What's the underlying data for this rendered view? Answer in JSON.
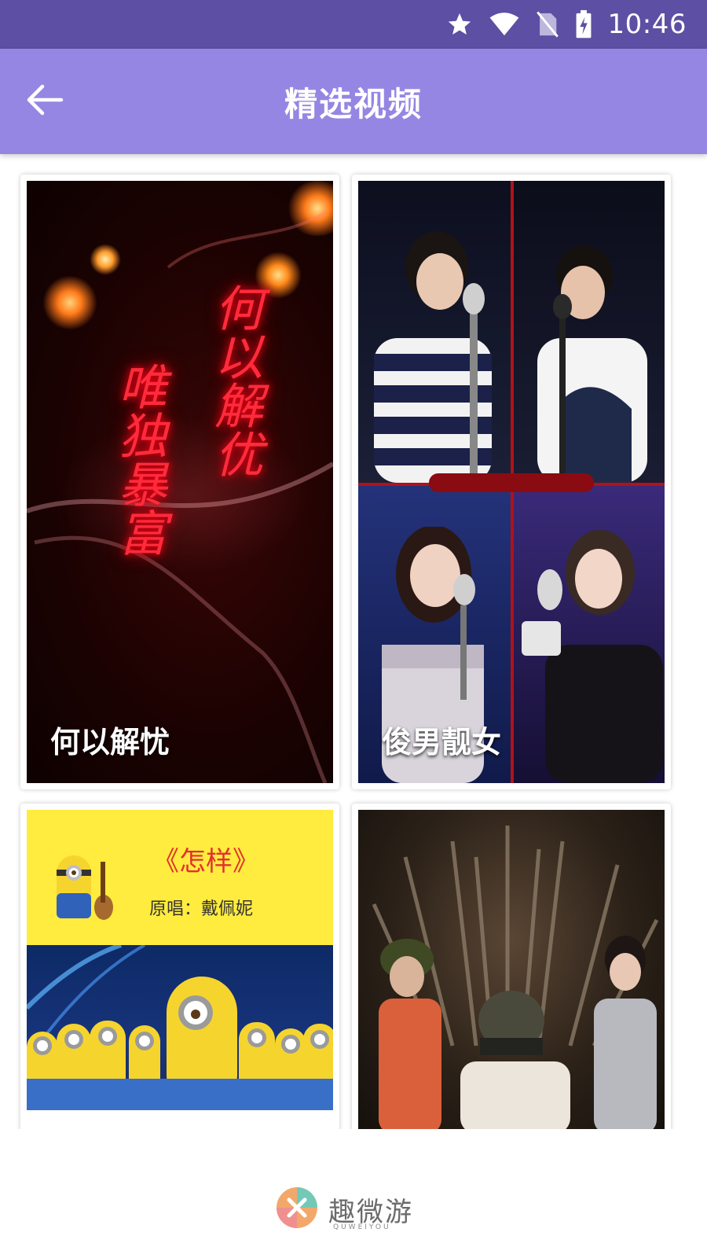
{
  "status_bar": {
    "time": "10:46",
    "icons": [
      "star-icon",
      "wifi-icon",
      "no-sim-icon",
      "battery-charging-icon"
    ]
  },
  "app_bar": {
    "title": "精选视频",
    "back_icon": "arrow-left-icon"
  },
  "videos": [
    {
      "caption": "何以解忧",
      "art_text": [
        "何以解优",
        "唯独暴富"
      ]
    },
    {
      "caption": "俊男靓女"
    },
    {
      "caption": "",
      "art_text": [
        "《怎样》",
        "原唱：戴佩妮"
      ]
    },
    {
      "caption": ""
    }
  ],
  "watermark": {
    "text": "趣微游",
    "sub": "QUWEIYOU"
  },
  "colors": {
    "status_bar": "#5d4fa3",
    "app_bar": "#9686e3",
    "caption_text": "#ffffff"
  }
}
